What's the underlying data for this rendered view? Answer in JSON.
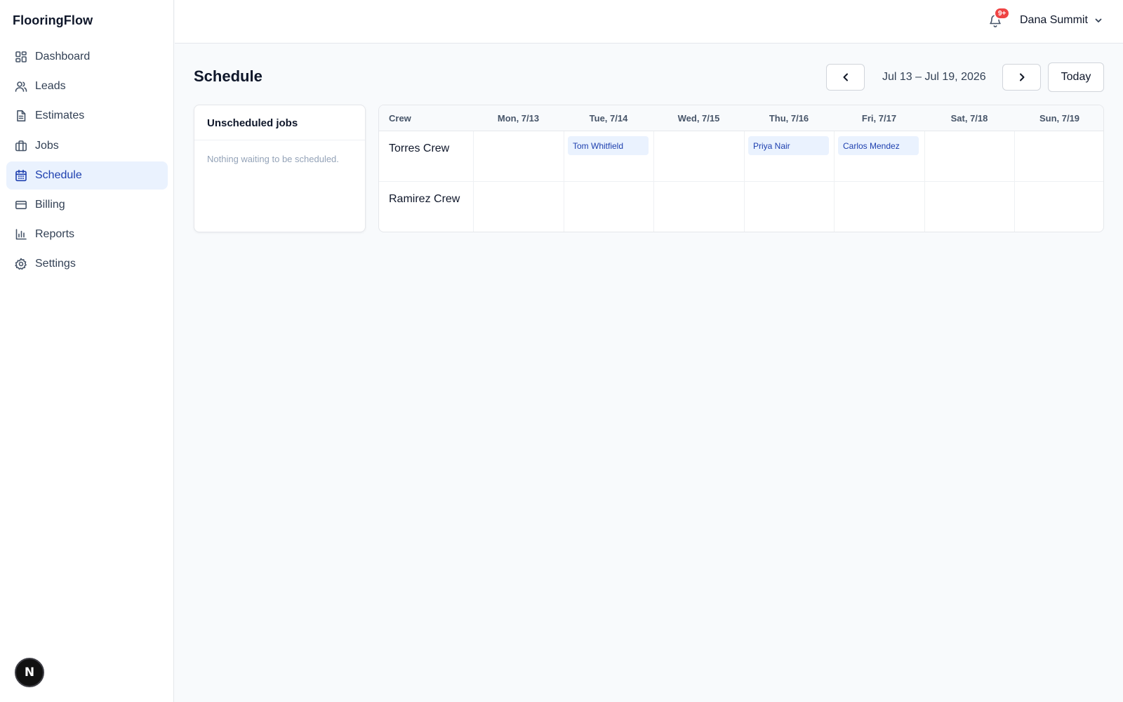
{
  "app": {
    "brand": "FlooringFlow"
  },
  "sidebar": {
    "items": [
      {
        "label": "Dashboard",
        "icon": "dashboard-icon",
        "active": false
      },
      {
        "label": "Leads",
        "icon": "users-icon",
        "active": false
      },
      {
        "label": "Estimates",
        "icon": "document-icon",
        "active": false
      },
      {
        "label": "Jobs",
        "icon": "briefcase-icon",
        "active": false
      },
      {
        "label": "Schedule",
        "icon": "calendar-icon",
        "active": true
      },
      {
        "label": "Billing",
        "icon": "credit-card-icon",
        "active": false
      },
      {
        "label": "Reports",
        "icon": "bar-chart-icon",
        "active": false
      },
      {
        "label": "Settings",
        "icon": "gear-icon",
        "active": false
      }
    ],
    "dev_badge": "N"
  },
  "topbar": {
    "notification_count": "9+",
    "user_name": "Dana Summit"
  },
  "page": {
    "title": "Schedule",
    "date_range": "Jul 13 – Jul 19, 2026",
    "today_label": "Today"
  },
  "unscheduled": {
    "title": "Unscheduled jobs",
    "empty_message": "Nothing waiting to be scheduled."
  },
  "schedule": {
    "headers": [
      "Crew",
      "Mon, 7/13",
      "Tue, 7/14",
      "Wed, 7/15",
      "Thu, 7/16",
      "Fri, 7/17",
      "Sat, 7/18",
      "Sun, 7/19"
    ],
    "crews": [
      {
        "name": "Torres Crew",
        "jobs": [
          "",
          "Tom Whitfield",
          "",
          "Priya Nair",
          "Carlos Mendez",
          "",
          ""
        ]
      },
      {
        "name": "Ramirez Crew",
        "jobs": [
          "",
          "",
          "",
          "",
          "",
          "",
          ""
        ]
      }
    ]
  },
  "colors": {
    "accent": "#1e40af",
    "active_bg": "#eaf2fe",
    "badge": "#ef4444"
  }
}
